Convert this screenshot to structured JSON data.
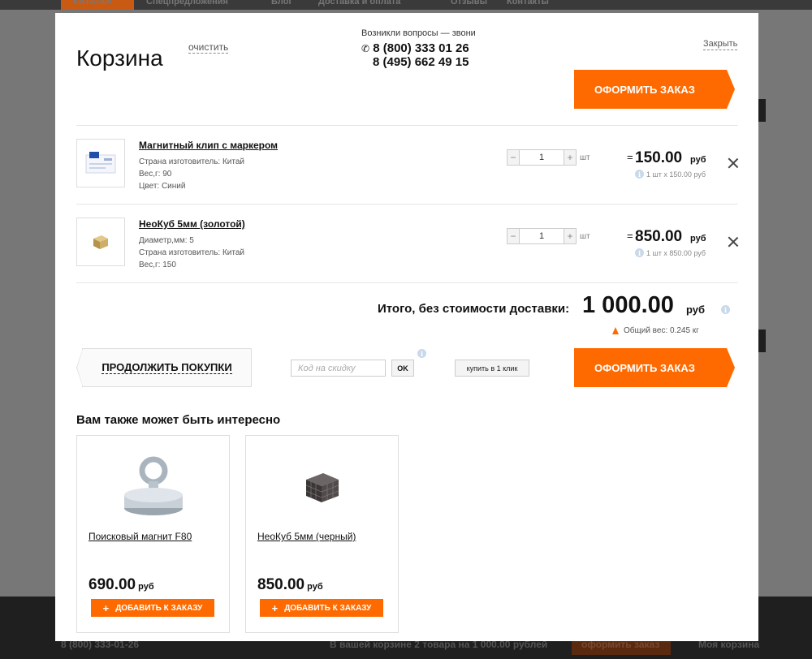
{
  "background": {
    "nav_items": [
      "КАТАЛОГ",
      "Спецпредложения",
      "Блог",
      "Доставка и оплата",
      "Отзывы",
      "Контакты"
    ],
    "footer_phone": "8 (800) 333-01-26",
    "footer_cart_text": "В вашей корзине 2 товара на 1 000.00 рублей",
    "footer_order": "оформить заказ",
    "footer_link": "Моя корзина"
  },
  "cart": {
    "title": "Корзина",
    "clear_label": "очистить",
    "close_label": "Закрыть",
    "order_label": "ОФОРМИТЬ ЗАКАЗ"
  },
  "contact": {
    "question": "Возникли вопросы — звони",
    "phone1": "8 (800) 333 01 26",
    "phone2": "8 (495) 662 49 15"
  },
  "items": [
    {
      "name": "Магнитный клип с маркером",
      "props": [
        "Страна изготовитель: Китай",
        "Вес,г: 90",
        "Цвет: Синий"
      ],
      "qty": "1",
      "unit": "шт",
      "eq": "=",
      "price": "150.00",
      "currency": "руб",
      "per_unit": "1 шт x 150.00 руб",
      "icon": "info-icon"
    },
    {
      "name": "НеоКуб 5мм (золотой)",
      "props": [
        "Диаметр,мм: 5",
        "Страна изготовитель: Китай",
        "Вес,г: 150"
      ],
      "qty": "1",
      "unit": "шт",
      "eq": "=",
      "price": "850.00",
      "currency": "руб",
      "per_unit": "1 шт x 850.00 руб",
      "icon": "info-icon"
    }
  ],
  "qty_controls": {
    "minus": "−",
    "plus": "+"
  },
  "total": {
    "label": "Итого, без стоимости доставки:",
    "value": "1 000.00",
    "currency": "руб",
    "weight": "Общий вес: 0.245 кг"
  },
  "actions": {
    "continue_label": "ПРОДОЛЖИТЬ ПОКУПКИ",
    "coupon_placeholder": "Код на скидку",
    "coupon_ok": "OK",
    "one_click": "купить в 1 клик",
    "info_glyph": "i"
  },
  "recommended": {
    "title": "Вам также может быть интересно",
    "products": [
      {
        "name": "Поисковый магнит F80",
        "price": "690.00",
        "currency": "руб",
        "add_label": "ДОБАВИТЬ К ЗАКАЗУ"
      },
      {
        "name": "НеоКуб 5мм (черный)",
        "price": "850.00",
        "currency": "руб",
        "add_label": "ДОБАВИТЬ К ЗАКАЗУ"
      }
    ]
  },
  "colors": {
    "accent": "#ff6a00",
    "overlay": "#777777"
  }
}
